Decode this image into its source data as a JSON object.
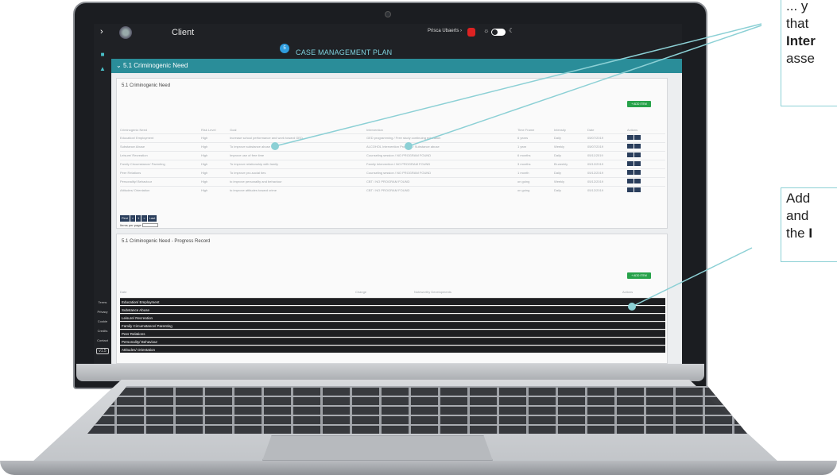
{
  "app": {
    "title": "Client",
    "user": "Prisca Ubaerts",
    "notifications": "1",
    "nav_footer": [
      "Terms",
      "Privacy",
      "Cookie",
      "Credits",
      "Contact"
    ],
    "version_badge": "v1.5"
  },
  "plan": {
    "step": "5",
    "title": "CASE MANAGEMENT PLAN",
    "section": "5.1 Criminogenic Need"
  },
  "needs": {
    "panel_title": "5.1 Criminogenic Need",
    "add_label": "ADD ITEM",
    "columns": [
      "Criminogenic Need",
      "Risk Level",
      "Goal",
      "Intervention",
      "Time Frame",
      "Intensity",
      "Date",
      "Actions"
    ],
    "rows": [
      [
        "Education/ Employment",
        "High",
        "Increase school performance and work toward GED",
        "GED programming / Free study continuing education",
        "6 years",
        "Daily",
        "05/07/2019"
      ],
      [
        "Substance Abuse",
        "High",
        "To improve substance abuse",
        "ALCOHOL Intervention Program / Substance abuse",
        "1 year",
        "Weekly",
        "05/07/2019"
      ],
      [
        "Leisure/ Recreation",
        "High",
        "Improve use of free time",
        "Counseling session / NO PROGRAM FOUND",
        "6 months",
        "Daily",
        "05/11/2019"
      ],
      [
        "Family Circumstance/ Parenting",
        "High",
        "To improve relationship with family",
        "Family Intervention / NO PROGRAM FOUND",
        "3 months",
        "Bi-weekly",
        "05/12/2019"
      ],
      [
        "Peer Relations",
        "High",
        "To improve pro-social ties",
        "Counseling session / NO PROGRAM FOUND",
        "1 month",
        "Daily",
        "05/12/2019"
      ],
      [
        "Personality/ Behaviour",
        "High",
        "to improve personality and behaviour",
        "CBT / NO PROGRAM FOUND",
        "on going",
        "Weekly",
        "05/12/2019"
      ],
      [
        "Attitudes/ Orientation",
        "High",
        "to improve attitudes toward crime",
        "CBT / NO PROGRAM FOUND",
        "on going",
        "Daily",
        "05/12/2019"
      ]
    ],
    "pager": [
      "First",
      "<",
      "1",
      ">",
      "Last"
    ],
    "per_page_label": "Items per page"
  },
  "progress": {
    "panel_title": "5.1 Criminogenic Need - Progress Record",
    "add_label": "ADD ITEM",
    "columns": [
      "Date",
      "Change",
      "Noteworthy Developments",
      "Actions"
    ],
    "categories": [
      "Education/ Employment",
      "Substance Abuse",
      "Leisure/ Recreation",
      "Family Circumstance/ Parenting",
      "Peer Relations",
      "Personality/ Behaviour",
      "Attitudes/ Orientation"
    ]
  },
  "callouts": {
    "top": [
      "... y",
      "that",
      "Inter",
      "asse"
    ],
    "top_bold_line": 2,
    "bottom": [
      "Add",
      "and",
      "the I"
    ],
    "bottom_bold_tail": "I"
  },
  "colors": {
    "accent": "#2a8d99",
    "dark": "#1f2125",
    "add_button": "#27a24a",
    "callout_border": "#8cd0d5"
  }
}
